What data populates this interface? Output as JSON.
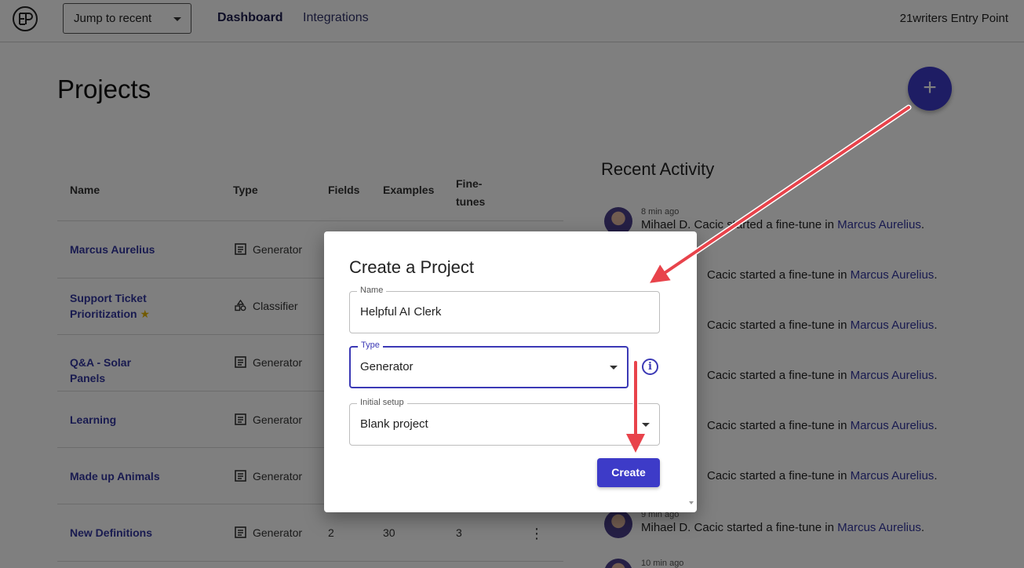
{
  "header": {
    "logo_text": "EP",
    "jump_label": "Jump to recent",
    "nav": [
      "Dashboard",
      "Integrations"
    ],
    "org_name": "21writers Entry Point"
  },
  "projects": {
    "title": "Projects",
    "add_label": "+",
    "columns": [
      "Name",
      "Type",
      "Fields",
      "Examples",
      "Fine-tunes"
    ],
    "rows": [
      {
        "name": "Marcus Aurelius",
        "type": "Generator"
      },
      {
        "name": "Support Ticket Prioritization",
        "type": "Classifier",
        "starred": "★"
      },
      {
        "name": "Q&A - Solar Panels",
        "type": "Generator"
      },
      {
        "name": "Learning",
        "type": "Generator"
      },
      {
        "name": "Made up Animals",
        "type": "Generator"
      },
      {
        "name": "New Definitions",
        "type": "Generator",
        "fields": "2",
        "examples": "30",
        "finetunes": "3",
        "menu": "⋮"
      }
    ]
  },
  "activity": {
    "title": "Recent Activity",
    "items": [
      {
        "time": "8 min ago",
        "text": "Mihael D. Cacic started a fine-tune in ",
        "link": "Marcus Aurelius",
        "suffix": "."
      },
      {
        "time": "",
        "text": "Cacic started a fine-tune in ",
        "link": "Marcus Aurelius",
        "suffix": "."
      },
      {
        "time": "",
        "text": "Cacic started a fine-tune in ",
        "link": "Marcus Aurelius",
        "suffix": "."
      },
      {
        "time": "",
        "text": "Cacic started a fine-tune in ",
        "link": "Marcus Aurelius",
        "suffix": "."
      },
      {
        "time": "",
        "text": "Cacic started a fine-tune in ",
        "link": "Marcus Aurelius",
        "suffix": "."
      },
      {
        "time": "",
        "text": "Cacic started a fine-tune in ",
        "link": "Marcus Aurelius",
        "suffix": "."
      },
      {
        "time": "9 min ago",
        "text": "Mihael D. Cacic started a fine-tune in ",
        "link": "Marcus Aurelius",
        "suffix": "."
      },
      {
        "time": "10 min ago",
        "text": "",
        "link": "",
        "suffix": ""
      }
    ]
  },
  "modal": {
    "title": "Create a Project",
    "name_label": "Name",
    "name_value": "Helpful AI Clerk",
    "type_label": "Type",
    "type_value": "Generator",
    "info_icon": "i",
    "setup_label": "Initial setup",
    "setup_value": "Blank project",
    "create_label": "Create"
  },
  "colors": {
    "accent": "#3d3bc8",
    "link": "#3336a0",
    "annotation_arrow": "#e8434b"
  }
}
